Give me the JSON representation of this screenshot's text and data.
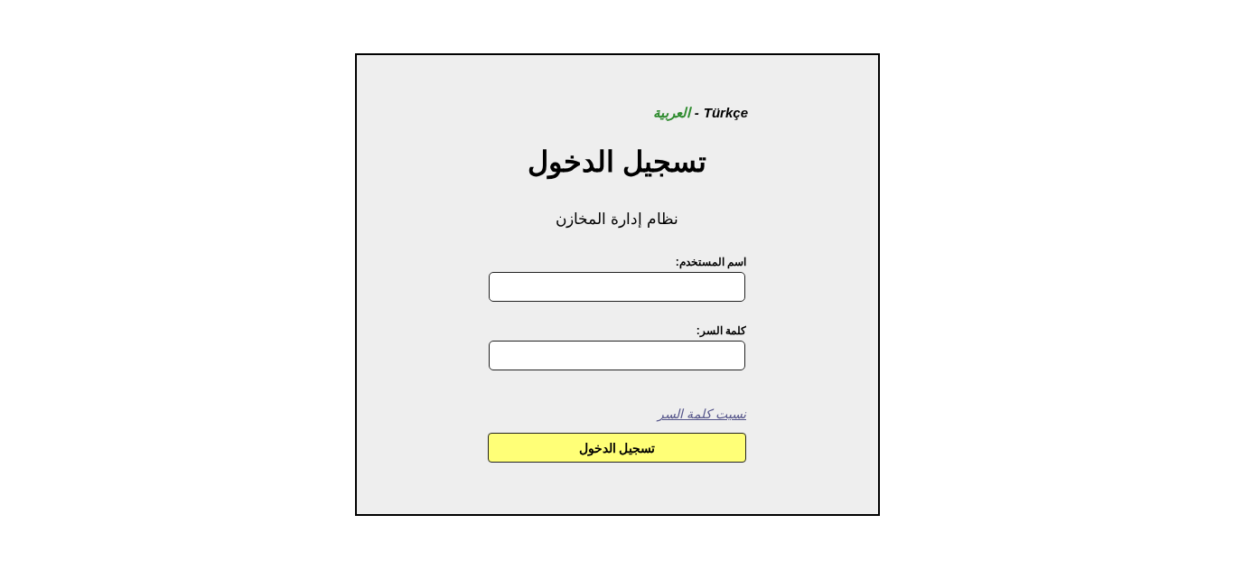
{
  "languages": [
    {
      "label": "Türkçe",
      "selected": false
    },
    {
      "label": "العربية",
      "selected": true
    }
  ],
  "language_separator": "-",
  "title": "تسجيل الدخول",
  "subtitle": "نظام إدارة المخازن",
  "fields": [
    {
      "label": "اسم المستخدم:"
    },
    {
      "label": "كلمة السر:"
    }
  ],
  "forgot_link": "نسيت كلمة السر",
  "submit_button": "تسجيل الدخول"
}
